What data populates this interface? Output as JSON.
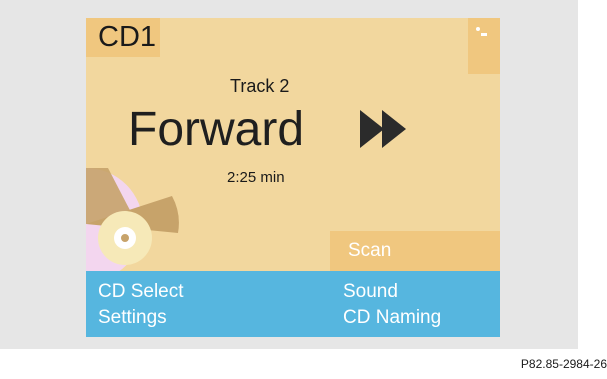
{
  "screen": {
    "source": "CD1",
    "track": "Track 2",
    "mode": "Forward",
    "time": "2:25 min",
    "scan": "Scan",
    "status_icon": "status-icon",
    "forward_icon": "fast-forward-icon",
    "disc_icon": "cd-disc-icon"
  },
  "softkeys": {
    "left_top": "CD Select",
    "left_bottom": "Settings",
    "right_top": "Sound",
    "right_bottom": "CD Naming"
  },
  "figure": {
    "code": "P82.85-2984-26"
  },
  "colors": {
    "screen_background": "#f2d79e",
    "tab_background": "#f0c77f",
    "softkey_background": "#56b6df",
    "text_dark": "#1a1a1a",
    "text_light": "#ffffff",
    "disc_pink": "#f3d6ef",
    "disc_tan": "#c7a36a"
  }
}
